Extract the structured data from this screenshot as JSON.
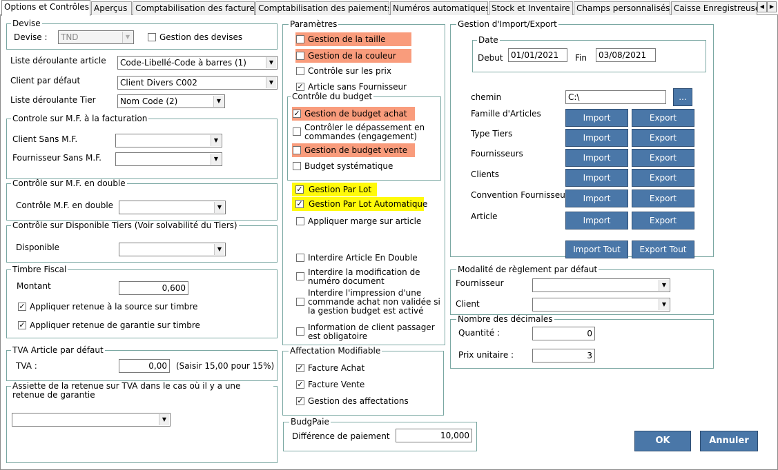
{
  "tabs": [
    "Options et Contrôles",
    "Aperçus",
    "Comptabilisation des factures",
    "Comptabilisation des paiements",
    "Numéros automatiques",
    "Stock et Inventaire",
    "Champs personnalisés",
    "Caisse Enregistreuse"
  ],
  "devise": {
    "title": "Devise",
    "label": "Devise :",
    "value": "TND",
    "gestion_label": "Gestion des devises"
  },
  "selects": {
    "article_label": "Liste déroulante article",
    "article_value": "Code-Libellé-Code à barres (1)",
    "client_label": "Client par défaut",
    "client_value": "Client Divers C002",
    "tier_label": "Liste déroulante Tier",
    "tier_value": "Nom Code (2)"
  },
  "mf_fact": {
    "title": "Controle sur M.F. à la facturation",
    "client_label": "Client Sans M.F.",
    "fournisseur_label": "Fournisseur Sans M.F."
  },
  "mf_double": {
    "title": "Contrôle sur M.F. en double",
    "label": "Contrôle M.F. en double"
  },
  "dispo": {
    "title": "Contrôle sur Disponible Tiers (Voir solvabilité du Tiers)",
    "label": "Disponible"
  },
  "timbre": {
    "title": "Timbre Fiscal",
    "montant_label": "Montant",
    "montant_value": "0,600",
    "chk1": "Appliquer retenue à la source sur timbre",
    "chk2": "Appliquer retenue de garantie sur timbre"
  },
  "tva": {
    "title": "TVA Article par défaut",
    "label": "TVA :",
    "value": "0,00",
    "hint": "(Saisir 15,00 pour 15%)"
  },
  "assiette": {
    "title": "Assiette de la retenue sur TVA dans le cas où il y a une retenue de garantie"
  },
  "parametres": {
    "title": "Paramètres",
    "taille": "Gestion de la taille",
    "couleur": "Gestion de la couleur",
    "prix": "Contrôle sur les prix",
    "sans_fournisseur": "Article sans Fournisseur",
    "budget_title": "Contrôle du budget",
    "budget_achat": "Gestion de budget achat",
    "depassement": "Contrôler le dépassement en commandes (engagement)",
    "budget_vente": "Gestion de budget vente",
    "budget_sys": "Budget systématique",
    "par_lot": "Gestion Par Lot",
    "par_lot_auto": "Gestion Par Lot Automatique",
    "marge": "Appliquer marge sur article",
    "interdire_double": "Interdire Article En Double",
    "interdire_modif": "Interdire la modification de numéro document",
    "interdire_impression": "Interdire l'impression d'une commande achat non validée si la gestion budget est activé",
    "info_client": "Information de client passager est obligatoire"
  },
  "affectation": {
    "title": "Affectation Modifiable",
    "facture_achat": "Facture Achat",
    "facture_vente": "Facture Vente",
    "gestion_aff": "Gestion des affectations"
  },
  "budgpaie": {
    "title": "BudgPaie",
    "label": "Différence de paiement",
    "value": "10,000"
  },
  "import_export": {
    "title": "Gestion d'Import/Export",
    "date_title": "Date",
    "debut_label": "Debut",
    "debut_value": "01/01/2021",
    "fin_label": "Fin",
    "fin_value": "03/08/2021",
    "chemin_label": "chemin",
    "chemin_value": "C:\\",
    "browse": "...",
    "rows": [
      "Famille d'Articles",
      "Type Tiers",
      "Fournisseurs",
      "Clients",
      "Convention Fournisseur",
      "Article"
    ],
    "import": "Import",
    "export": "Export",
    "import_tout": "Import Tout",
    "export_tout": "Export Tout"
  },
  "reglement": {
    "title": "Modalité de règlement par défaut",
    "fournisseur_label": "Fournisseur",
    "client_label": "Client"
  },
  "decimales": {
    "title": "Nombre des décimales",
    "quantite_label": "Quantité :",
    "quantite_value": "0",
    "prix_label": "Prix unitaire :",
    "prix_value": "3"
  },
  "actions": {
    "ok": "OK",
    "annuler": "Annuler"
  },
  "colors": {
    "highlight_orange": "#f99c7c",
    "highlight_yellow": "#fffa0a",
    "button_blue": "#4a77a8",
    "group_border": "#7aa7a2"
  }
}
